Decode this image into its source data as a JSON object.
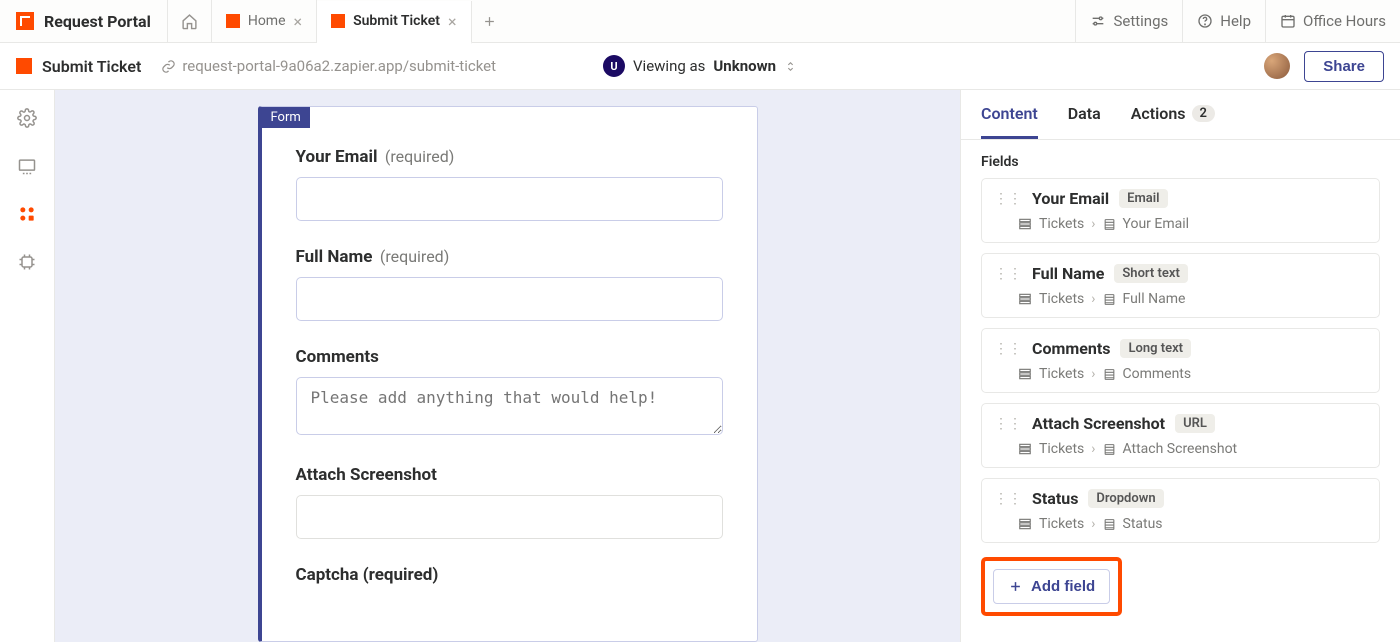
{
  "brand": {
    "name": "Request Portal"
  },
  "tabs": [
    {
      "label": "Home"
    },
    {
      "label": "Submit Ticket"
    }
  ],
  "topbar_right": {
    "settings": "Settings",
    "help": "Help",
    "office_hours": "Office Hours"
  },
  "subheader": {
    "title": "Submit Ticket",
    "url": "request-portal-9a06a2.zapier.app/submit-ticket",
    "viewing_prefix": "Viewing as ",
    "viewing_as": "Unknown",
    "share": "Share"
  },
  "form": {
    "badge": "Form",
    "fields": [
      {
        "label": "Your Email",
        "required": "(required)",
        "type": "text",
        "placeholder": ""
      },
      {
        "label": "Full Name",
        "required": "(required)",
        "type": "text",
        "placeholder": ""
      },
      {
        "label": "Comments",
        "required": "",
        "type": "textarea",
        "placeholder": "Please add anything that would help!"
      },
      {
        "label": "Attach Screenshot",
        "required": "",
        "type": "text",
        "placeholder": ""
      },
      {
        "label": "Captcha (required)",
        "required": "",
        "type": "none",
        "placeholder": ""
      }
    ]
  },
  "right_panel": {
    "tabs": {
      "content": "Content",
      "data": "Data",
      "actions": "Actions",
      "actions_count": "2"
    },
    "section_title": "Fields",
    "fields": [
      {
        "name": "Your Email",
        "type": "Email",
        "path_table": "Tickets",
        "path_field": "Your Email"
      },
      {
        "name": "Full Name",
        "type": "Short text",
        "path_table": "Tickets",
        "path_field": "Full Name"
      },
      {
        "name": "Comments",
        "type": "Long text",
        "path_table": "Tickets",
        "path_field": "Comments"
      },
      {
        "name": "Attach Screenshot",
        "type": "URL",
        "path_table": "Tickets",
        "path_field": "Attach Screenshot"
      },
      {
        "name": "Status",
        "type": "Dropdown",
        "path_table": "Tickets",
        "path_field": "Status"
      }
    ],
    "add_field": "Add field"
  }
}
